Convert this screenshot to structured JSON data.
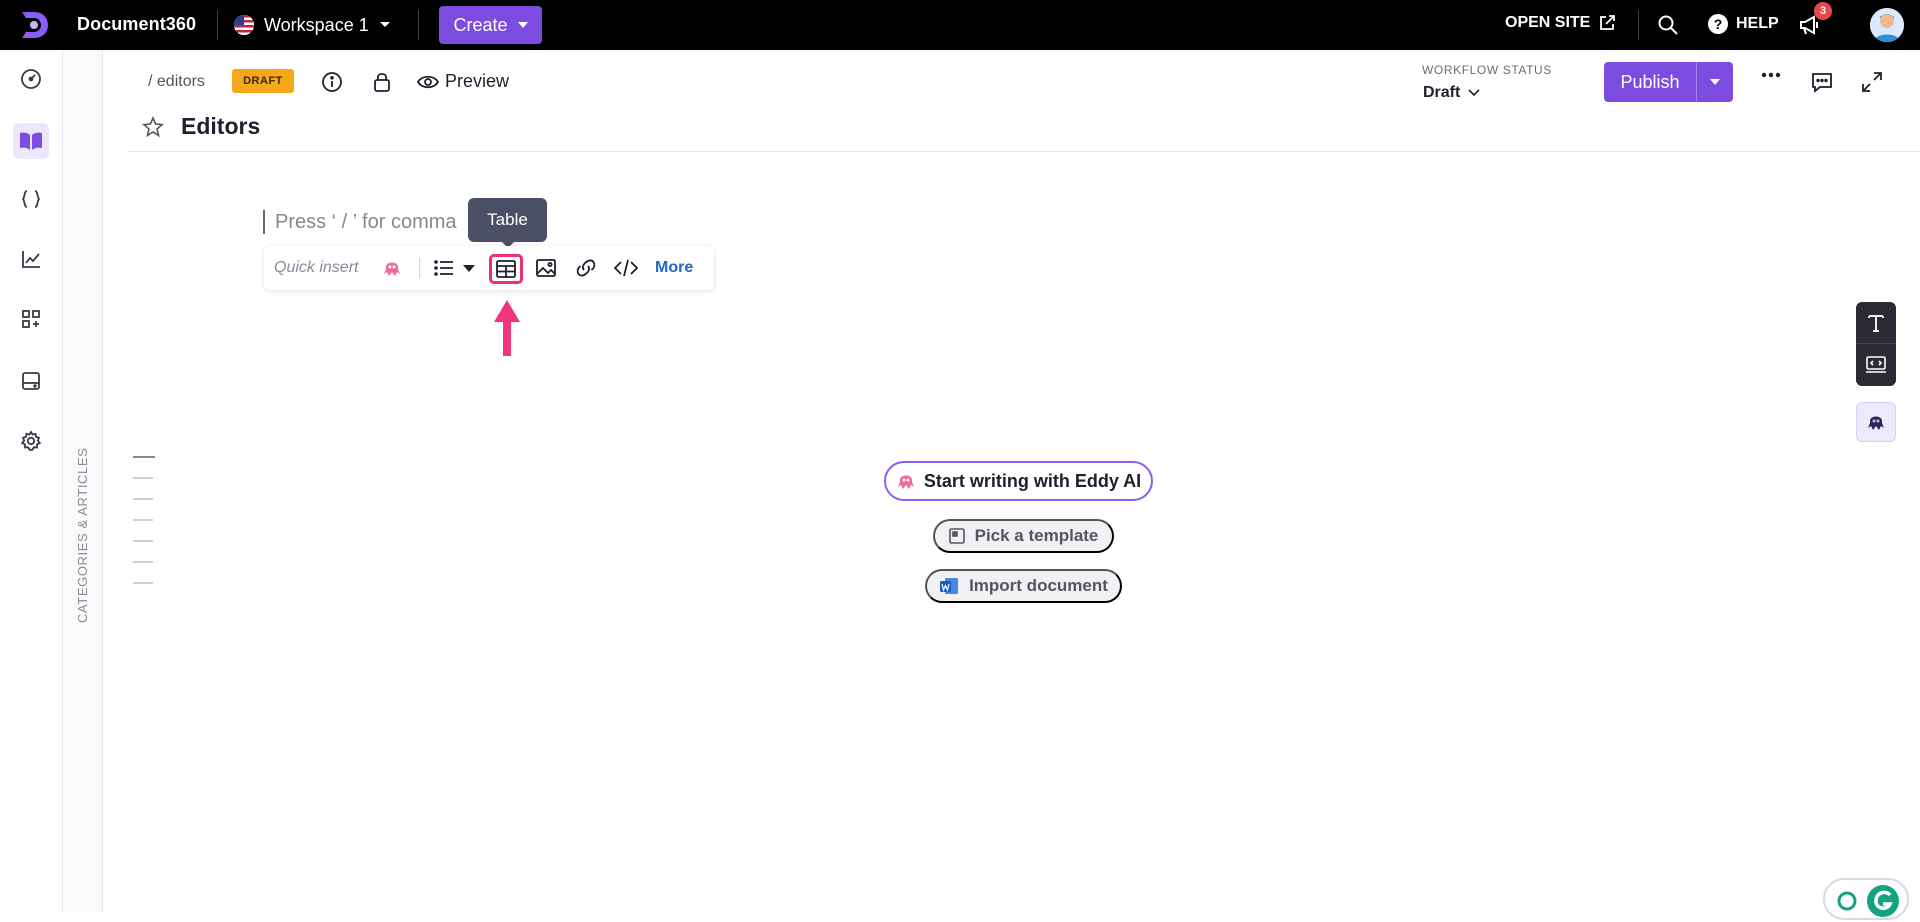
{
  "topbar": {
    "brand": "Document360",
    "workspace": "Workspace 1",
    "create_label": "Create",
    "open_site_label": "OPEN SITE",
    "help_label": "HELP",
    "notification_count": "3"
  },
  "rail": {
    "items": [
      "dashboard-icon",
      "documentation-icon",
      "api-icon",
      "analytics-icon",
      "apps-icon",
      "widgets-icon",
      "settings-icon"
    ],
    "active": "documentation-icon",
    "category_label": "CATEGORIES & ARTICLES"
  },
  "header": {
    "breadcrumb": "/ editors",
    "status_badge": "DRAFT",
    "preview_label": "Preview",
    "title": "Editors",
    "workflow_label": "WORKFLOW STATUS",
    "workflow_value": "Draft",
    "publish_label": "Publish"
  },
  "editor": {
    "placeholder": "Press ‘ / ’ for comma",
    "quick_insert_label": "Quick insert",
    "more_label": "More",
    "tooltip": "Table"
  },
  "actions": {
    "eddy_label": "Start writing with Eddy AI",
    "template_label": "Pick a template",
    "import_label": "Import document"
  },
  "colors": {
    "accent": "#7c4ce0",
    "draft": "#f6a81b",
    "highlight": "#e8336e",
    "link": "#2266cc"
  }
}
